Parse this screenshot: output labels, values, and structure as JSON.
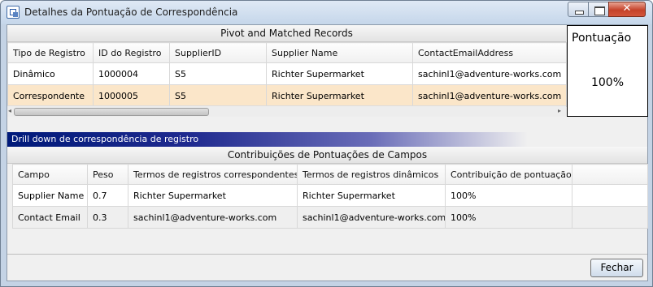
{
  "window": {
    "title": "Detalhes da Pontuação de Correspondência"
  },
  "pivot": {
    "title": "Pivot and Matched Records",
    "columns": [
      "Tipo de Registro",
      "ID do Registro",
      "SupplierID",
      "Supplier Name",
      "ContactEmailAddress"
    ],
    "rows": [
      [
        "Dinâmico",
        "1000004",
        "S5",
        "Richter Supermarket",
        "sachinl1@adventure-works.com"
      ],
      [
        "Correspondente",
        "1000005",
        "S5",
        "Richter Supermarket",
        "sachinl1@adventure-works.com"
      ]
    ]
  },
  "score": {
    "label": "Pontuação",
    "value": "100%"
  },
  "drilldown": {
    "header": "Drill down de correspondência de registro"
  },
  "contributions": {
    "title": "Contribuições de Pontuações de Campos",
    "columns": [
      "Campo",
      "Peso",
      "Termos de registros correspondentes",
      "Termos de registros dinâmicos",
      "Contribuição de pontuação"
    ],
    "rows": [
      [
        "Supplier Name",
        "0.7",
        "Richter Supermarket",
        "Richter Supermarket",
        "100%"
      ],
      [
        "Contact Email",
        "0.3",
        "sachinl1@adventure-works.com",
        "sachinl1@adventure-works.com",
        "100%"
      ]
    ]
  },
  "footer": {
    "close_label": "Fechar"
  },
  "colors": {
    "selected_row": "#fbe6c9",
    "drill_header": "#001a7a"
  }
}
